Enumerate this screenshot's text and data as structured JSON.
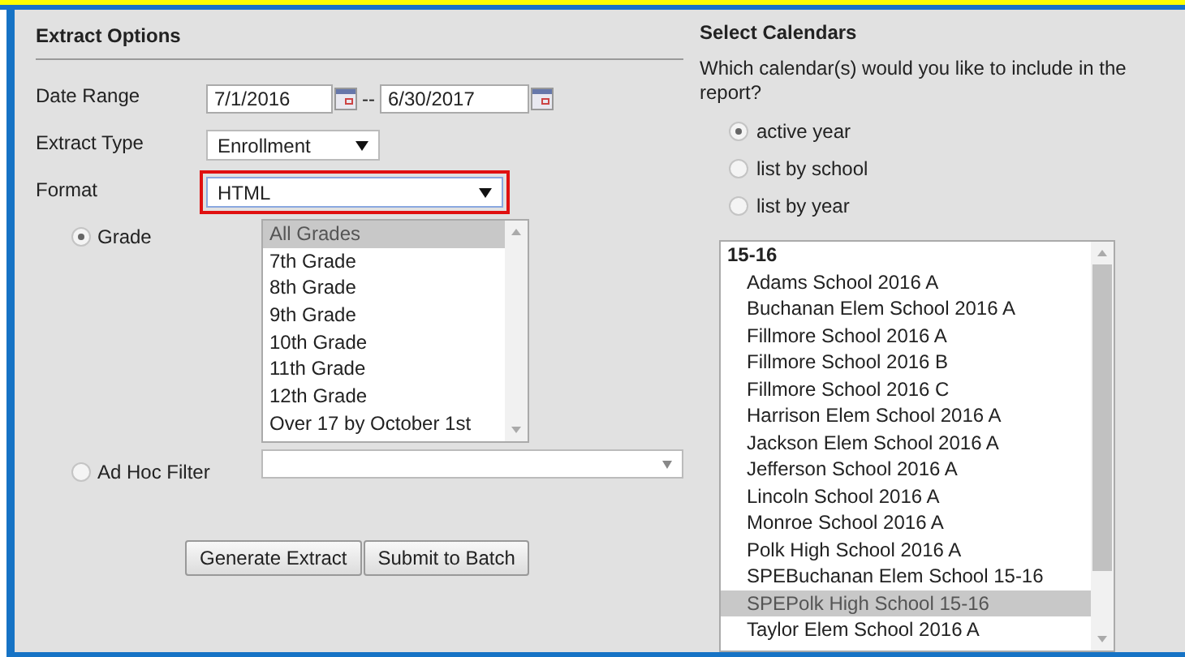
{
  "extract_options": {
    "title": "Extract Options",
    "date_range": {
      "label": "Date Range",
      "start": "7/1/2016",
      "separator": "--",
      "end": "6/30/2017"
    },
    "extract_type": {
      "label": "Extract Type",
      "value": "Enrollment"
    },
    "format": {
      "label": "Format",
      "value": "HTML",
      "highlighted": true
    },
    "filters": [
      {
        "kind": "list",
        "label": "Grade",
        "selected": true,
        "items": [
          {
            "label": "All Grades",
            "selected": true
          },
          {
            "label": "7th Grade",
            "selected": false
          },
          {
            "label": "8th Grade",
            "selected": false
          },
          {
            "label": "9th Grade",
            "selected": false
          },
          {
            "label": "10th Grade",
            "selected": false
          },
          {
            "label": "11th Grade",
            "selected": false
          },
          {
            "label": "12th Grade",
            "selected": false
          },
          {
            "label": "Over 17 by October 1st",
            "selected": false
          }
        ]
      },
      {
        "kind": "dropdown",
        "label": "Ad Hoc Filter",
        "selected": false
      }
    ],
    "buttons": [
      "Generate Extract",
      "Submit to Batch"
    ]
  },
  "select_calendars": {
    "title": "Select Calendars",
    "question": "Which calendar(s) would you like to include in the report?",
    "options": [
      {
        "label": "active year",
        "selected": true
      },
      {
        "label": "list by school",
        "selected": false
      },
      {
        "label": "list by year",
        "selected": false
      }
    ],
    "group": "15-16",
    "calendars": [
      {
        "label": "Adams School 2016 A",
        "selected": false
      },
      {
        "label": "Buchanan Elem School 2016 A",
        "selected": false
      },
      {
        "label": "Fillmore School 2016 A",
        "selected": false
      },
      {
        "label": "Fillmore School 2016 B",
        "selected": false
      },
      {
        "label": "Fillmore School 2016 C",
        "selected": false
      },
      {
        "label": "Harrison Elem School 2016 A",
        "selected": false
      },
      {
        "label": "Jackson Elem School 2016 A",
        "selected": false
      },
      {
        "label": "Jefferson School 2016 A",
        "selected": false
      },
      {
        "label": "Lincoln School 2016 A",
        "selected": false
      },
      {
        "label": "Monroe School 2016 A",
        "selected": false
      },
      {
        "label": "Polk High School 2016 A",
        "selected": false
      },
      {
        "label": "SPEBuchanan Elem School 15-16",
        "selected": false
      },
      {
        "label": "SPEPolk High School 15-16",
        "selected": true
      },
      {
        "label": "Taylor Elem School 2016 A",
        "selected": false
      }
    ]
  }
}
